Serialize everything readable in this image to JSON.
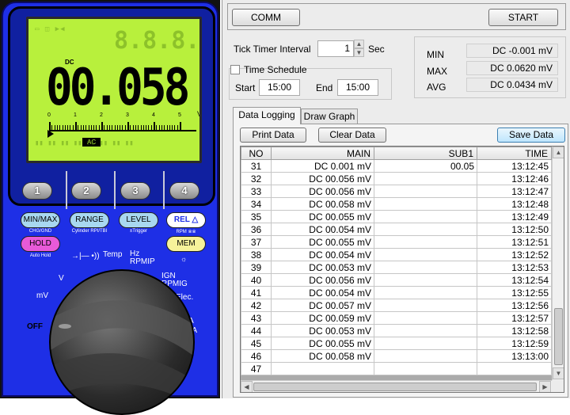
{
  "meter": {
    "lcd_main": "00.058",
    "lcd_ghost": "8.8.8.8",
    "lcd_mode_top": "DC",
    "lcd_unit": "V",
    "lcd_ac_badge": "AC",
    "scale_labels": [
      "0",
      "1",
      "2",
      "3",
      "4",
      "5"
    ],
    "number_buttons": [
      "1",
      "2",
      "3",
      "4"
    ],
    "fn_buttons": {
      "minmax": "MIN/MAX",
      "minmax_sub": "CHG/GND",
      "range": "RANGE",
      "range_sub": "Cylinder RPI/TBI",
      "level": "LEVEL",
      "level_sub": "±Trigger",
      "rel": "REL △",
      "rel_sub": "RPM ※※",
      "hold": "HOLD",
      "hold_sub": "Auto Hold",
      "mem": "MEM"
    },
    "dial_labels": {
      "diode": "→|—  •))",
      "temp": "Temp",
      "hz": "Hz RPMIP",
      "ign": "IGN RPMIG",
      "v": "V",
      "mv": "mV",
      "elec": "Elec.",
      "off": "OFF",
      "a": "A",
      "ma": "mA"
    },
    "colors": {
      "body": "#1e2fe6",
      "lcd": "#b8f03c"
    }
  },
  "toolbar": {
    "comm": "COMM",
    "start": "START"
  },
  "timer": {
    "label": "Tick Timer Interval",
    "value": "1",
    "unit": "Sec"
  },
  "schedule": {
    "label": "Time Schedule",
    "start_label": "Start",
    "start_value": "15:00",
    "end_label": "End",
    "end_value": "15:00"
  },
  "stats": {
    "min_label": "MIN",
    "min_value": "DC  -0.001 mV",
    "max_label": "MAX",
    "max_value": "DC  0.0620 mV",
    "avg_label": "AVG",
    "avg_value": "DC  0.0434 mV"
  },
  "tabs": {
    "logging": "Data Logging",
    "graph": "Draw Graph"
  },
  "actions": {
    "print": "Print Data",
    "clear": "Clear Data",
    "save": "Save Data"
  },
  "table": {
    "headers": [
      "NO",
      "MAIN",
      "SUB1",
      "TIME"
    ],
    "rows": [
      [
        "31",
        "DC  0.001 mV",
        "00.05",
        "13:12:45"
      ],
      [
        "32",
        "DC  00.056 mV",
        "",
        "13:12:46"
      ],
      [
        "33",
        "DC  00.056 mV",
        "",
        "13:12:47"
      ],
      [
        "34",
        "DC  00.058 mV",
        "",
        "13:12:48"
      ],
      [
        "35",
        "DC  00.055 mV",
        "",
        "13:12:49"
      ],
      [
        "36",
        "DC  00.054 mV",
        "",
        "13:12:50"
      ],
      [
        "37",
        "DC  00.055 mV",
        "",
        "13:12:51"
      ],
      [
        "38",
        "DC  00.054 mV",
        "",
        "13:12:52"
      ],
      [
        "39",
        "DC  00.053 mV",
        "",
        "13:12:53"
      ],
      [
        "40",
        "DC  00.056 mV",
        "",
        "13:12:54"
      ],
      [
        "41",
        "DC  00.054 mV",
        "",
        "13:12:55"
      ],
      [
        "42",
        "DC  00.057 mV",
        "",
        "13:12:56"
      ],
      [
        "43",
        "DC  00.059 mV",
        "",
        "13:12:57"
      ],
      [
        "44",
        "DC  00.053 mV",
        "",
        "13:12:58"
      ],
      [
        "45",
        "DC  00.055 mV",
        "",
        "13:12:59"
      ],
      [
        "46",
        "DC  00.058 mV",
        "",
        "13:13:00"
      ],
      [
        "47",
        "",
        "",
        ""
      ]
    ]
  }
}
